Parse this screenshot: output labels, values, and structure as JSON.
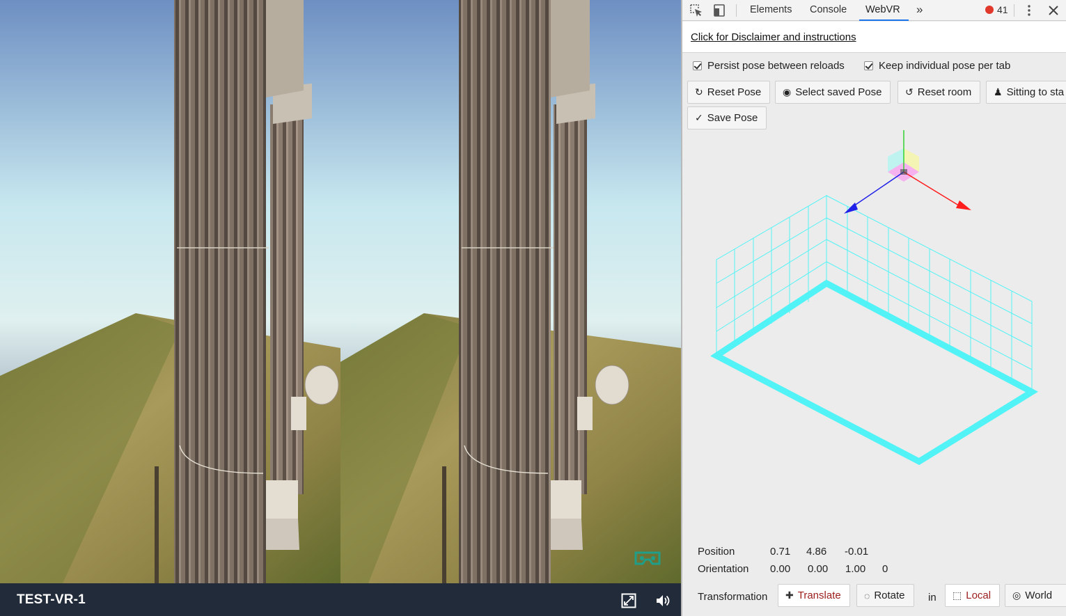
{
  "viewer": {
    "title": "TEST-VR-1",
    "icons": {
      "fullscreen": "fullscreen-icon",
      "volume": "volume-icon",
      "vr_badge": "cardboard-icon"
    }
  },
  "devtools": {
    "tabs": [
      {
        "label": "Elements",
        "active": false
      },
      {
        "label": "Console",
        "active": false
      },
      {
        "label": "WebVR",
        "active": true
      }
    ],
    "overflow_label": "»",
    "error_count": "41",
    "error_color": "#e0392b",
    "accent_color": "#1a73e8",
    "disclaimer_link": "Click for Disclaimer and instructions",
    "options": {
      "persist_pose": {
        "label": "Persist pose between reloads",
        "checked": true
      },
      "keep_pose": {
        "label": "Keep individual pose per tab",
        "checked": true
      }
    },
    "buttons": {
      "reset_pose": "Reset Pose",
      "select_saved_pose": "Select saved Pose",
      "reset_room": "Reset room",
      "sitting_to_standing": "Sitting to sta",
      "save_pose": "Save Pose"
    },
    "readout": {
      "position_label": "Position",
      "position": [
        "0.71",
        "4.86",
        "-0.01"
      ],
      "orientation_label": "Orientation",
      "orientation": [
        "0.00",
        "0.00",
        "1.00",
        "0"
      ]
    },
    "transformation": {
      "label": "Transformation",
      "translate": "Translate",
      "rotate": "Rotate",
      "in_label": "in",
      "local": "Local",
      "world": "World",
      "selected_mode": "Translate",
      "selected_space": "Local"
    },
    "scene_colors": {
      "room": "#52f3f6",
      "axis_x": "#ff1e1e",
      "axis_y": "#32d232",
      "axis_z": "#2020e8"
    }
  }
}
